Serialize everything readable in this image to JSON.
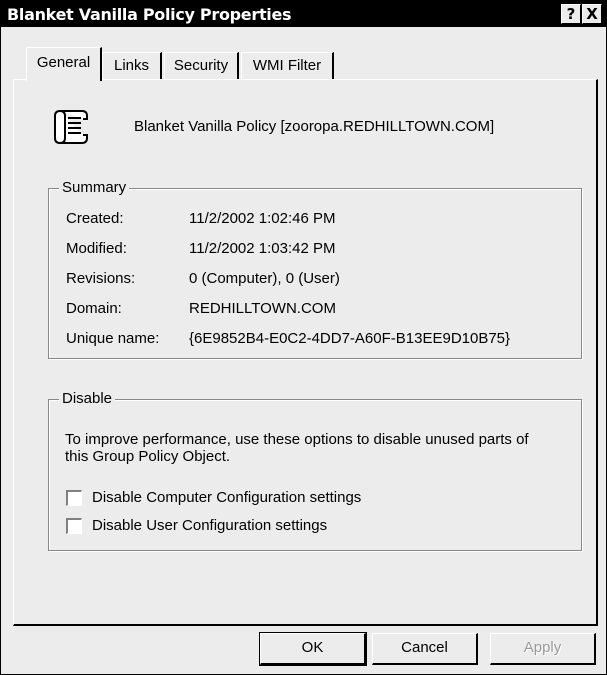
{
  "window": {
    "title": "Blanket Vanilla Policy Properties",
    "help_label": "?",
    "close_label": "X"
  },
  "tabs": [
    {
      "label": "General",
      "active": true
    },
    {
      "label": "Links",
      "active": false
    },
    {
      "label": "Security",
      "active": false
    },
    {
      "label": "WMI Filter",
      "active": false
    }
  ],
  "general": {
    "icon": "scroll-icon",
    "policy_full_name": "Blanket Vanilla Policy [zooropa.REDHILLTOWN.COM]"
  },
  "summary": {
    "title": "Summary",
    "rows": [
      {
        "key": "Created:",
        "value": "11/2/2002 1:02:46 PM"
      },
      {
        "key": "Modified:",
        "value": "11/2/2002 1:03:42 PM"
      },
      {
        "key": "Revisions:",
        "value": "0 (Computer), 0 (User)"
      },
      {
        "key": "Domain:",
        "value": "REDHILLTOWN.COM"
      },
      {
        "key": "Unique name:",
        "value": "{6E9852B4-E0C2-4DD7-A60F-B13EE9D10B75}"
      }
    ]
  },
  "disable": {
    "title": "Disable",
    "description": "To improve performance, use these options to disable unused parts of this Group Policy Object.",
    "options": [
      {
        "label": "Disable Computer Configuration settings",
        "checked": false
      },
      {
        "label": "Disable User Configuration settings",
        "checked": false
      }
    ]
  },
  "buttons": {
    "ok": "OK",
    "cancel": "Cancel",
    "apply": "Apply"
  }
}
